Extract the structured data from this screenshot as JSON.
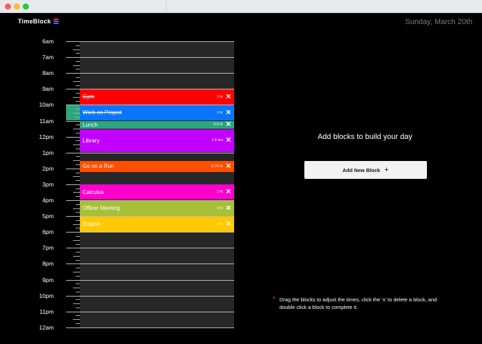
{
  "app": {
    "title": "TimeBlock",
    "date": "Sunday, March 20th"
  },
  "colors": {
    "logo_stripes": [
      "#ff2a2a",
      "#7b5cff",
      "#3a6cff"
    ],
    "handle": "#2aa77f"
  },
  "timeline": {
    "hours": [
      "6am",
      "7am",
      "8am",
      "9am",
      "10am",
      "11am",
      "12pm",
      "1pm",
      "2pm",
      "3pm",
      "4pm",
      "5pm",
      "6pm",
      "7pm",
      "8pm",
      "9pm",
      "10pm",
      "11pm",
      "12am"
    ]
  },
  "blocks": [
    {
      "name": "Gym",
      "duration": "1 hr",
      "start_hour": 9.0,
      "hours": 1.0,
      "color": "#ff0000",
      "completed": true
    },
    {
      "name": "Work on Project",
      "duration": "1 hr",
      "start_hour": 10.0,
      "hours": 1.0,
      "color": "#0a74ff",
      "completed": true
    },
    {
      "name": "Lunch",
      "duration": "0.5 hr",
      "start_hour": 11.0,
      "hours": 0.5,
      "color": "#2aa77f",
      "completed": false
    },
    {
      "name": "Library",
      "duration": "1.5 hrs",
      "start_hour": 11.5,
      "hours": 1.5,
      "color": "#c100ff",
      "completed": false
    },
    {
      "name": "Go on a Run",
      "duration": "0.75 hr",
      "start_hour": 13.5,
      "hours": 0.75,
      "color": "#ff4f00",
      "completed": false
    },
    {
      "name": "Calculus",
      "duration": "1 hr",
      "start_hour": 15.0,
      "hours": 1.0,
      "color": "#ff00cc",
      "completed": false
    },
    {
      "name": "Officer Meeting",
      "duration": "1 hr",
      "start_hour": 16.0,
      "hours": 1.0,
      "color": "#a8bf3a",
      "completed": false
    },
    {
      "name": "English",
      "duration": "1 hr",
      "start_hour": 17.0,
      "hours": 1.0,
      "color": "#ffc800",
      "completed": false
    }
  ],
  "panel": {
    "prompt": "Add blocks to build your day",
    "add_label": "Add New Block",
    "add_icon": "+",
    "help_star": "*",
    "help_text": "Drag the blocks to adjust the times, click the 'x' to delete a block, and double click a block to complete it."
  },
  "icons": {
    "close": "✕"
  }
}
